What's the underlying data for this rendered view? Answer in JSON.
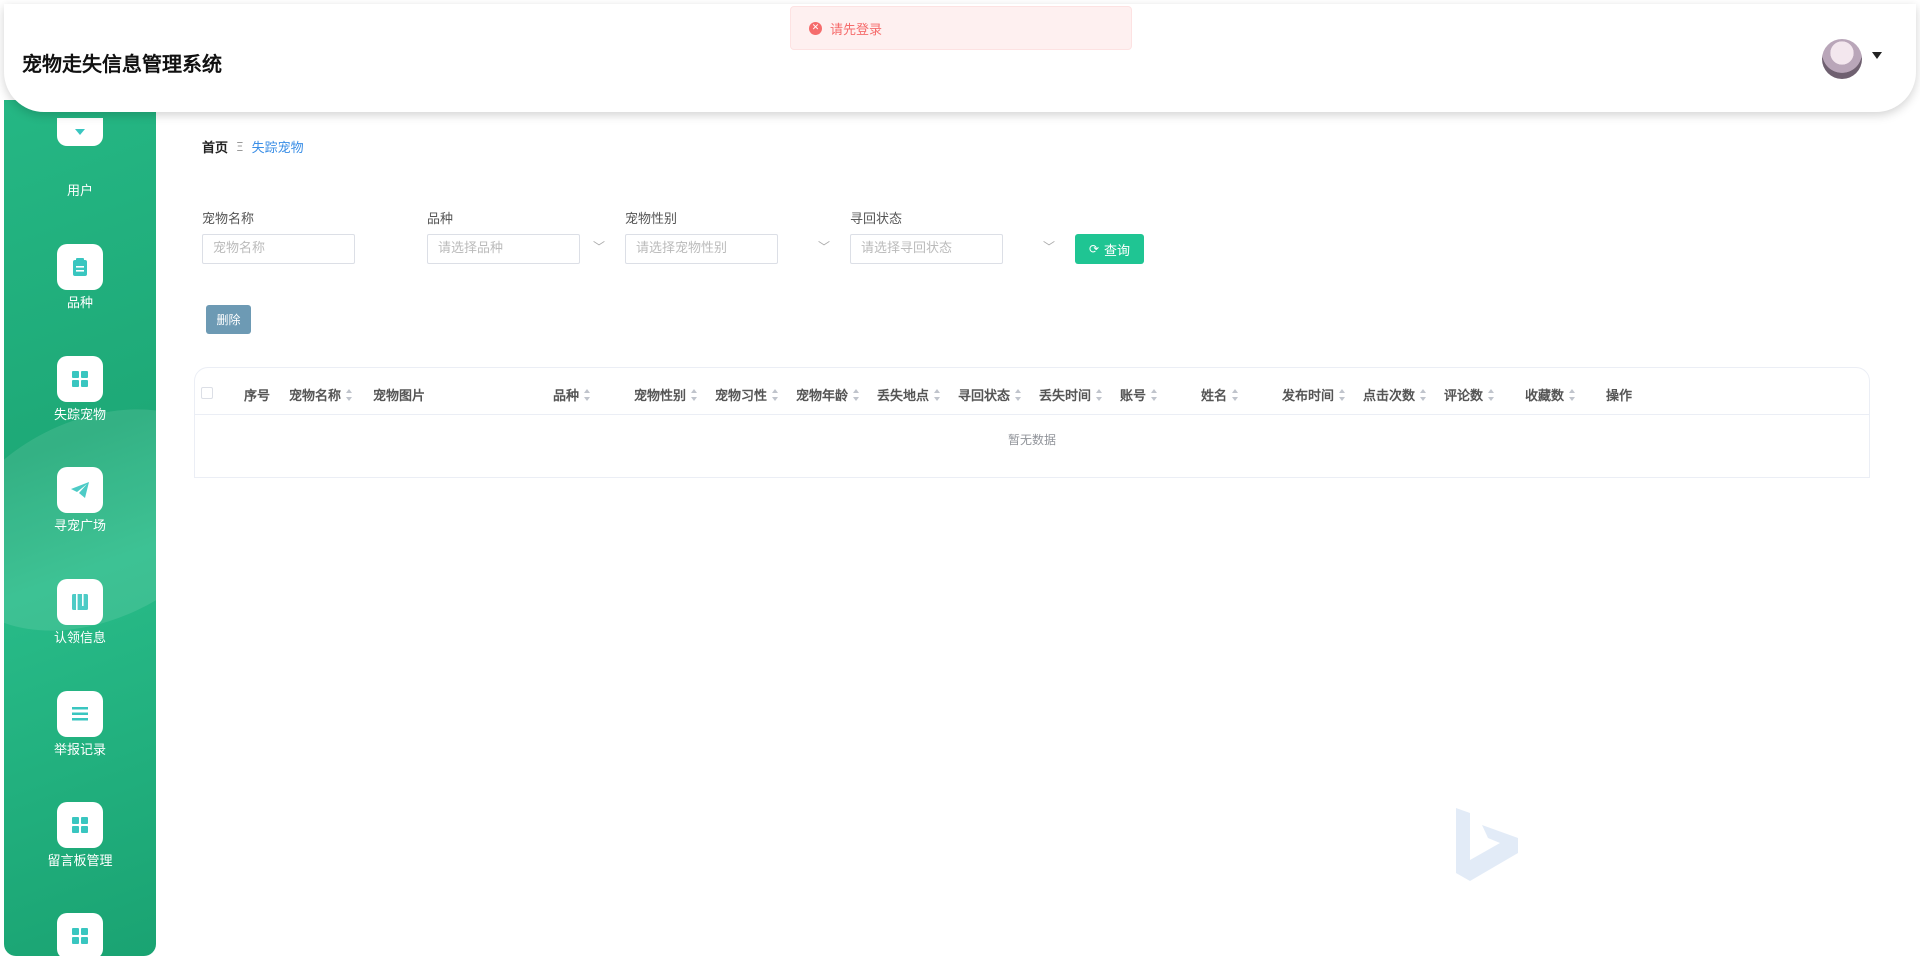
{
  "app": {
    "title": "宠物走失信息管理系统"
  },
  "toast": {
    "message": "请先登录",
    "type": "error"
  },
  "sidebar": {
    "items": [
      {
        "label": "用户",
        "icon": "user-icon"
      },
      {
        "label": "品种",
        "icon": "clipboard-icon"
      },
      {
        "label": "失踪宠物",
        "icon": "grid-icon"
      },
      {
        "label": "寻宠广场",
        "icon": "paper-plane-icon"
      },
      {
        "label": "认领信息",
        "icon": "book-icon"
      },
      {
        "label": "举报记录",
        "icon": "list-icon"
      },
      {
        "label": "留言板管理",
        "icon": "grid-icon"
      },
      {
        "label": "",
        "icon": "grid-icon"
      }
    ]
  },
  "breadcrumb": {
    "home": "首页",
    "separator": "Ξ",
    "current": "失踪宠物"
  },
  "filters": {
    "pet_name": {
      "label": "宠物名称",
      "placeholder": "宠物名称"
    },
    "breed": {
      "label": "品种",
      "placeholder": "请选择品种"
    },
    "gender": {
      "label": "宠物性别",
      "placeholder": "请选择宠物性别"
    },
    "status": {
      "label": "寻回状态",
      "placeholder": "请选择寻回状态"
    },
    "query_label": "查询"
  },
  "actions": {
    "delete_label": "删除"
  },
  "table": {
    "columns": [
      "序号",
      "宠物名称",
      "宠物图片",
      "品种",
      "宠物性别",
      "宠物习性",
      "宠物年龄",
      "丢失地点",
      "寻回状态",
      "丢失时间",
      "账号",
      "姓名",
      "发布时间",
      "点击次数",
      "评论数",
      "收藏数",
      "操作"
    ],
    "empty_text": "暂无数据"
  },
  "colors": {
    "accent": "#1fc593",
    "sidebar": "#22b07e",
    "link": "#3a8ee6",
    "delete": "#6d9ab4",
    "error": "#f56c6c"
  }
}
